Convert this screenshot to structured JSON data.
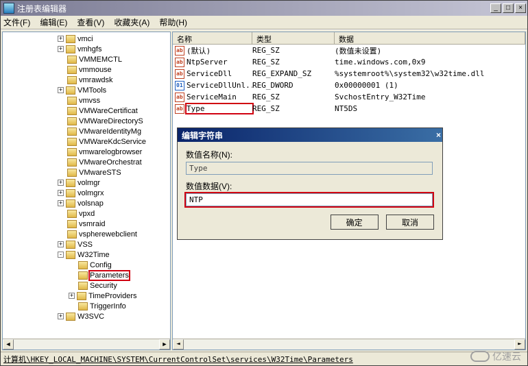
{
  "app": {
    "title": "注册表编辑器"
  },
  "menu": {
    "file": "文件(F)",
    "edit": "编辑(E)",
    "view": "查看(V)",
    "favorites": "收藏夹(A)",
    "help": "帮助(H)"
  },
  "tree": {
    "items": [
      {
        "indent": 5,
        "toggle": "+",
        "label": "vmci"
      },
      {
        "indent": 5,
        "toggle": "+",
        "label": "vmhgfs"
      },
      {
        "indent": 5,
        "toggle": "",
        "label": "VMMEMCTL"
      },
      {
        "indent": 5,
        "toggle": "",
        "label": "vmmouse"
      },
      {
        "indent": 5,
        "toggle": "",
        "label": "vmrawdsk"
      },
      {
        "indent": 5,
        "toggle": "+",
        "label": "VMTools"
      },
      {
        "indent": 5,
        "toggle": "",
        "label": "vmvss"
      },
      {
        "indent": 5,
        "toggle": "",
        "label": "VMWareCertificat"
      },
      {
        "indent": 5,
        "toggle": "",
        "label": "VMWareDirectoryS"
      },
      {
        "indent": 5,
        "toggle": "",
        "label": "VMwareIdentityMg"
      },
      {
        "indent": 5,
        "toggle": "",
        "label": "VMWareKdcService"
      },
      {
        "indent": 5,
        "toggle": "",
        "label": "vmwarelogbrowser"
      },
      {
        "indent": 5,
        "toggle": "",
        "label": "VMwareOrchestrat"
      },
      {
        "indent": 5,
        "toggle": "",
        "label": "VMwareSTS"
      },
      {
        "indent": 5,
        "toggle": "+",
        "label": "volmgr"
      },
      {
        "indent": 5,
        "toggle": "+",
        "label": "volmgrx"
      },
      {
        "indent": 5,
        "toggle": "+",
        "label": "volsnap"
      },
      {
        "indent": 5,
        "toggle": "",
        "label": "vpxd"
      },
      {
        "indent": 5,
        "toggle": "",
        "label": "vsmraid"
      },
      {
        "indent": 5,
        "toggle": "",
        "label": "vspherewebclient"
      },
      {
        "indent": 5,
        "toggle": "+",
        "label": "VSS"
      },
      {
        "indent": 5,
        "toggle": "-",
        "label": "W32Time"
      },
      {
        "indent": 6,
        "toggle": "",
        "label": "Config"
      },
      {
        "indent": 6,
        "toggle": "",
        "label": "Parameters",
        "highlight": true
      },
      {
        "indent": 6,
        "toggle": "",
        "label": "Security"
      },
      {
        "indent": 6,
        "toggle": "+",
        "label": "TimeProviders"
      },
      {
        "indent": 6,
        "toggle": "",
        "label": "TriggerInfo"
      },
      {
        "indent": 5,
        "toggle": "+",
        "label": "W3SVC"
      }
    ]
  },
  "list": {
    "headers": {
      "name": "名称",
      "type": "类型",
      "data": "数据"
    },
    "rows": [
      {
        "icon": "str",
        "name": "(默认)",
        "type": "REG_SZ",
        "data": "(数值未设置)"
      },
      {
        "icon": "str",
        "name": "NtpServer",
        "type": "REG_SZ",
        "data": "time.windows.com,0x9"
      },
      {
        "icon": "str",
        "name": "ServiceDll",
        "type": "REG_EXPAND_SZ",
        "data": "%systemroot%\\system32\\w32time.dll"
      },
      {
        "icon": "bin",
        "name": "ServiceDllUnl...",
        "type": "REG_DWORD",
        "data": "0x00000001 (1)"
      },
      {
        "icon": "str",
        "name": "ServiceMain",
        "type": "REG_SZ",
        "data": "SvchostEntry_W32Time"
      },
      {
        "icon": "str",
        "name": "Type",
        "type": "REG_SZ",
        "data": "NT5DS",
        "highlight": true
      }
    ]
  },
  "dialog": {
    "title": "编辑字符串",
    "name_label": "数值名称(N):",
    "name_value": "Type",
    "data_label": "数值数据(V):",
    "data_value": "NTP",
    "ok": "确定",
    "cancel": "取消"
  },
  "status": {
    "path": "计算机\\HKEY_LOCAL_MACHINE\\SYSTEM\\CurrentControlSet\\services\\W32Time\\Parameters"
  },
  "watermark": "亿速云"
}
